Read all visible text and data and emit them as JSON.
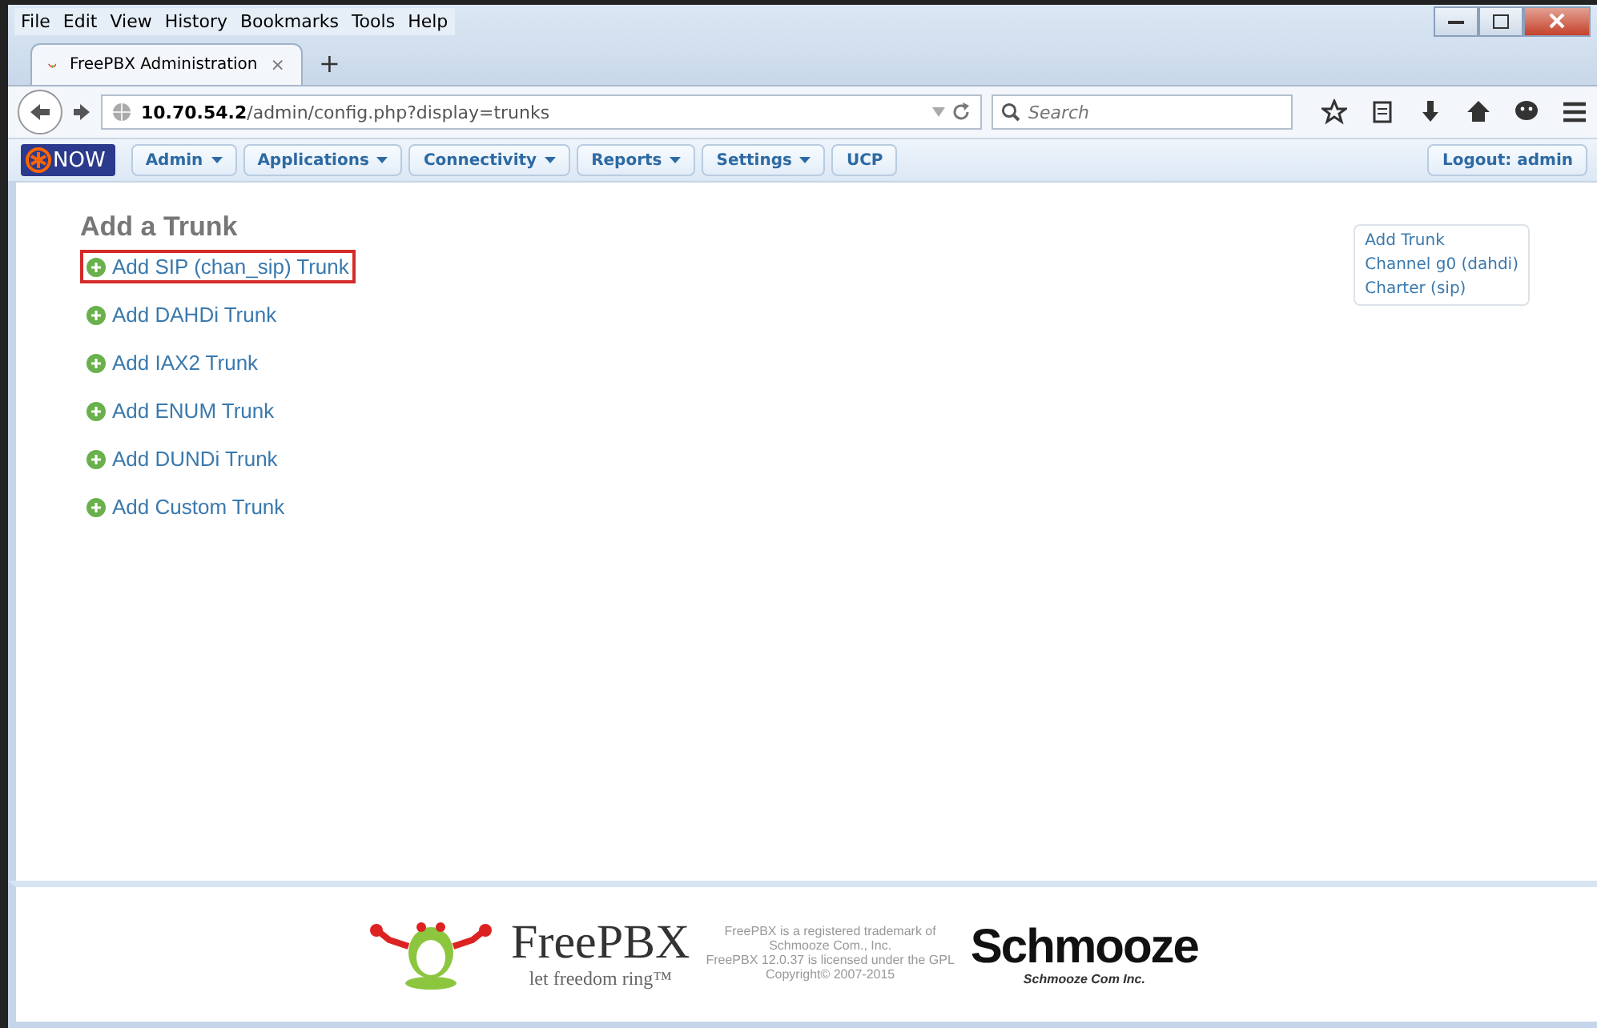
{
  "menu": [
    "File",
    "Edit",
    "View",
    "History",
    "Bookmarks",
    "Tools",
    "Help"
  ],
  "tab": {
    "title": "FreePBX Administration",
    "close": "×",
    "new_tab": "+"
  },
  "address": {
    "host": "10.70.54.2",
    "path": "/admin/config.php?display=trunks"
  },
  "search": {
    "placeholder": "Search"
  },
  "app_nav": {
    "logo": "NOW",
    "items": [
      {
        "label": "Admin",
        "dropdown": true
      },
      {
        "label": "Applications",
        "dropdown": true
      },
      {
        "label": "Connectivity",
        "dropdown": true
      },
      {
        "label": "Reports",
        "dropdown": true
      },
      {
        "label": "Settings",
        "dropdown": true
      },
      {
        "label": "UCP",
        "dropdown": false
      }
    ],
    "logout": "Logout: admin"
  },
  "heading": "Add a Trunk",
  "trunk_links": [
    {
      "label": "Add SIP (chan_sip) Trunk",
      "highlighted": true
    },
    {
      "label": "Add DAHDi Trunk",
      "highlighted": false
    },
    {
      "label": "Add IAX2 Trunk",
      "highlighted": false
    },
    {
      "label": "Add ENUM Trunk",
      "highlighted": false
    },
    {
      "label": "Add DUNDi Trunk",
      "highlighted": false
    },
    {
      "label": "Add Custom Trunk",
      "highlighted": false
    }
  ],
  "side_menu": [
    "Add Trunk",
    "Channel g0 (dahdi)",
    "Charter (sip)"
  ],
  "footer": {
    "brand": "FreePBX",
    "tagline": "let freedom ring™",
    "legal": [
      "FreePBX is a registered trademark of",
      "Schmooze Com., Inc.",
      "FreePBX 12.0.37 is licensed under the GPL",
      "Copyright© 2007-2015"
    ],
    "company": "Schmooze",
    "company_sub": "Schmooze Com Inc."
  }
}
